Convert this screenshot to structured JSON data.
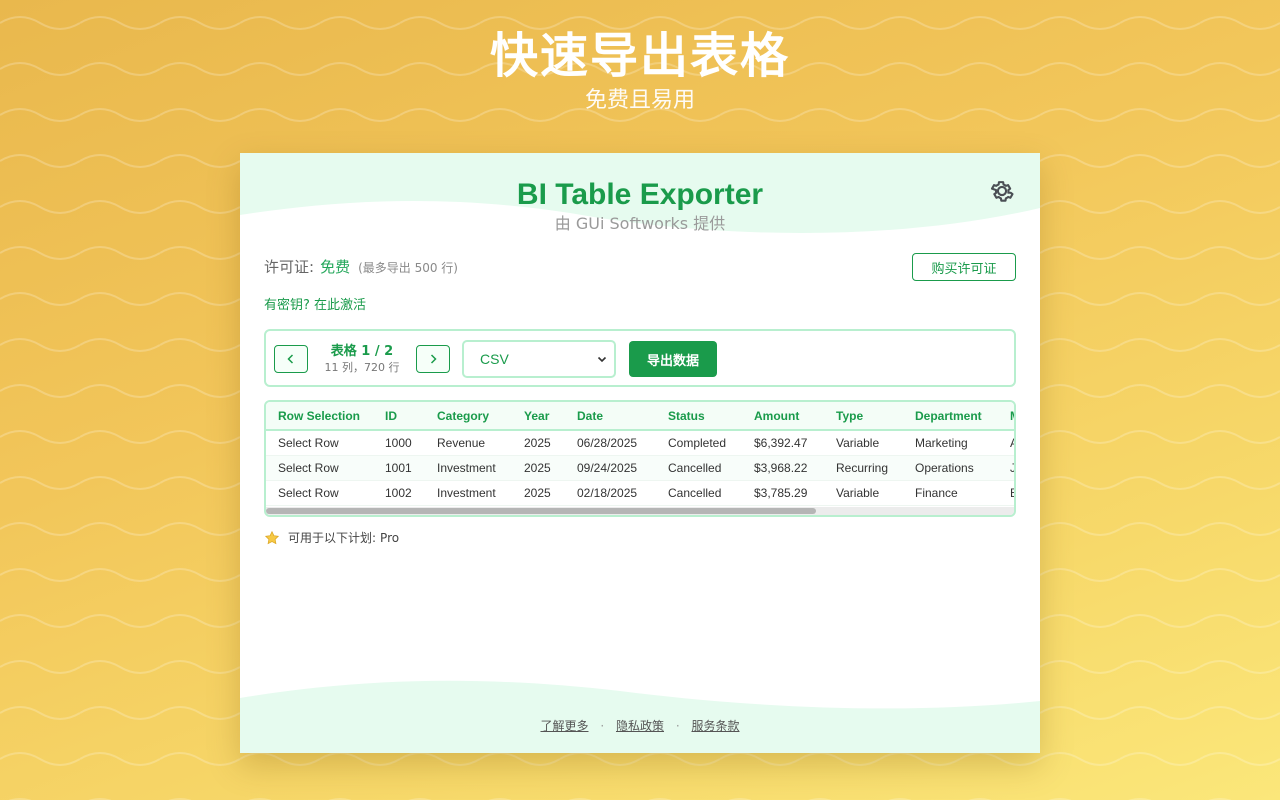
{
  "hero": {
    "title": "快速导出表格",
    "subtitle": "免费且易用"
  },
  "app": {
    "title": "BI Table Exporter",
    "subtitle": "由 GUi Softworks 提供",
    "settings_icon": "gear-icon"
  },
  "license": {
    "label": "许可证:",
    "value": "免费",
    "note": "(最多导出 500 行)",
    "buy_label": "购买许可证",
    "activate_label": "有密钥? 在此激活"
  },
  "toolbar": {
    "prev_icon": "chevron-left-icon",
    "next_icon": "chevron-right-icon",
    "table_name": "表格 1 / 2",
    "table_meta": "11 列，720 行",
    "format": "CSV",
    "export_label": "导出数据"
  },
  "table": {
    "columns": [
      "Row Selection",
      "ID",
      "Category",
      "Year",
      "Date",
      "Status",
      "Amount",
      "Type",
      "Department",
      "M"
    ],
    "rows": [
      [
        "Select Row",
        "1000",
        "Revenue",
        "2025",
        "06/28/2025",
        "Completed",
        "$6,392.47",
        "Variable",
        "Marketing",
        "A"
      ],
      [
        "Select Row",
        "1001",
        "Investment",
        "2025",
        "09/24/2025",
        "Cancelled",
        "$3,968.22",
        "Recurring",
        "Operations",
        "J"
      ],
      [
        "Select Row",
        "1002",
        "Investment",
        "2025",
        "02/18/2025",
        "Cancelled",
        "$3,785.29",
        "Variable",
        "Finance",
        "E"
      ]
    ]
  },
  "plan": {
    "icon": "star-icon",
    "label": "可用于以下计划:",
    "value": "Pro"
  },
  "footer": {
    "learn_more": "了解更多",
    "privacy": "隐私政策",
    "terms": "服务条款",
    "separator": "·"
  },
  "colors": {
    "accent": "#1a9b4b",
    "accent_light": "#b8efcf",
    "background_top": "#e9b84d",
    "background_bottom": "#fbe77a"
  }
}
